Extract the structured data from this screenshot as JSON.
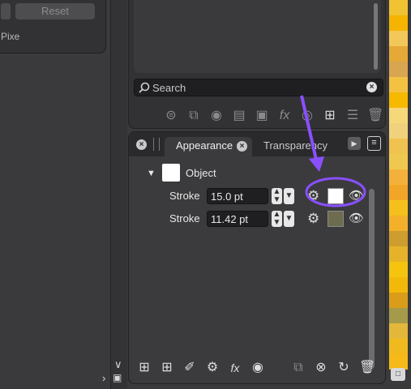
{
  "top_dialog": {
    "reset_label": "Reset",
    "partial_label": "Pixe"
  },
  "search": {
    "placeholder": "Search",
    "clear_icon": "clear-circle-icon"
  },
  "layers_toolbar": {
    "icons": [
      "adjustments-icon",
      "duplicate-icon",
      "mask-icon",
      "group-icon",
      "clip-icon",
      "fx-icon",
      "snapshot-icon",
      "add-layer-icon",
      "layer-stack-icon",
      "trash-icon"
    ]
  },
  "tabs": {
    "appearance": "Appearance",
    "transparency": "Transparency"
  },
  "appearance": {
    "object_label": "Object",
    "strokes": [
      {
        "label": "Stroke",
        "value": "15.0 pt",
        "color": "#ffffff"
      },
      {
        "label": "Stroke",
        "value": "11.42 pt",
        "color": "#6e6c4e"
      }
    ]
  },
  "bottom_toolbar": {
    "icons": [
      "add-fill-icon",
      "add-stroke-icon",
      "brush-icon",
      "settings-icon",
      "fx-icon",
      "camera-icon",
      "duplicate-icon",
      "remove-icon",
      "sync-icon",
      "trash-icon"
    ]
  },
  "annotation": {
    "arrow_color": "#8a4fff",
    "highlight_target": "stroke-1-color-swatch"
  },
  "swatch_column": {
    "colors": [
      "#f1c232",
      "#f4b400",
      "#f3c85a",
      "#e5a937",
      "#d8a550",
      "#f3c243",
      "#f7b800",
      "#f5d87a",
      "#f1d27c",
      "#f0c24f",
      "#efc94f",
      "#f3b13c",
      "#f1a627",
      "#f5c01b",
      "#f3b12b",
      "#cd9d2d",
      "#e5b329",
      "#f4c40f",
      "#f3b90a",
      "#d99d1a",
      "#a59a49",
      "#e3b83a",
      "#f0ba1e",
      "#f5b918"
    ]
  }
}
